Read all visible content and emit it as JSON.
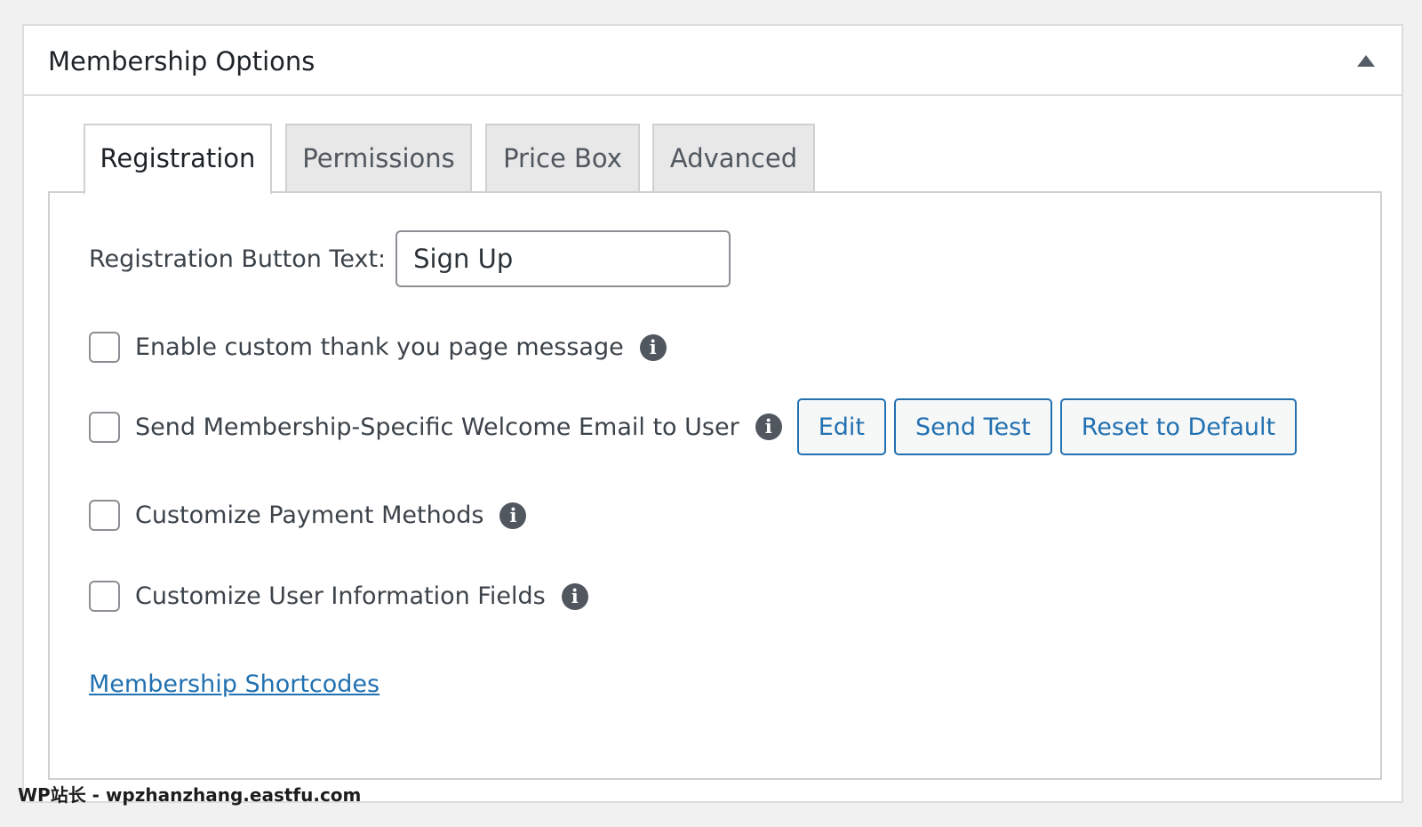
{
  "postbox": {
    "title": "Membership Options"
  },
  "tabs": [
    {
      "label": "Registration",
      "active": true
    },
    {
      "label": "Permissions",
      "active": false
    },
    {
      "label": "Price Box",
      "active": false
    },
    {
      "label": "Advanced",
      "active": false
    }
  ],
  "registration": {
    "button_text_label": "Registration Button Text:",
    "button_text_value": "Sign Up",
    "options": [
      {
        "label": "Enable custom thank you page message",
        "checked": false
      },
      {
        "label": "Send Membership-Specific Welcome Email to User",
        "checked": false
      },
      {
        "label": "Customize Payment Methods",
        "checked": false
      },
      {
        "label": "Customize User Information Fields",
        "checked": false
      }
    ],
    "email_buttons": {
      "edit": "Edit",
      "send_test": "Send Test",
      "reset": "Reset to Default"
    },
    "shortcodes_link": "Membership Shortcodes"
  },
  "icons": {
    "info": "info-icon",
    "collapse": "triangle-up-icon"
  },
  "colors": {
    "accent": "#2271b1",
    "background": "#f1f1f1",
    "panel": "#ffffff"
  },
  "watermark": "WP站长 - wpzhanzhang.eastfu.com"
}
